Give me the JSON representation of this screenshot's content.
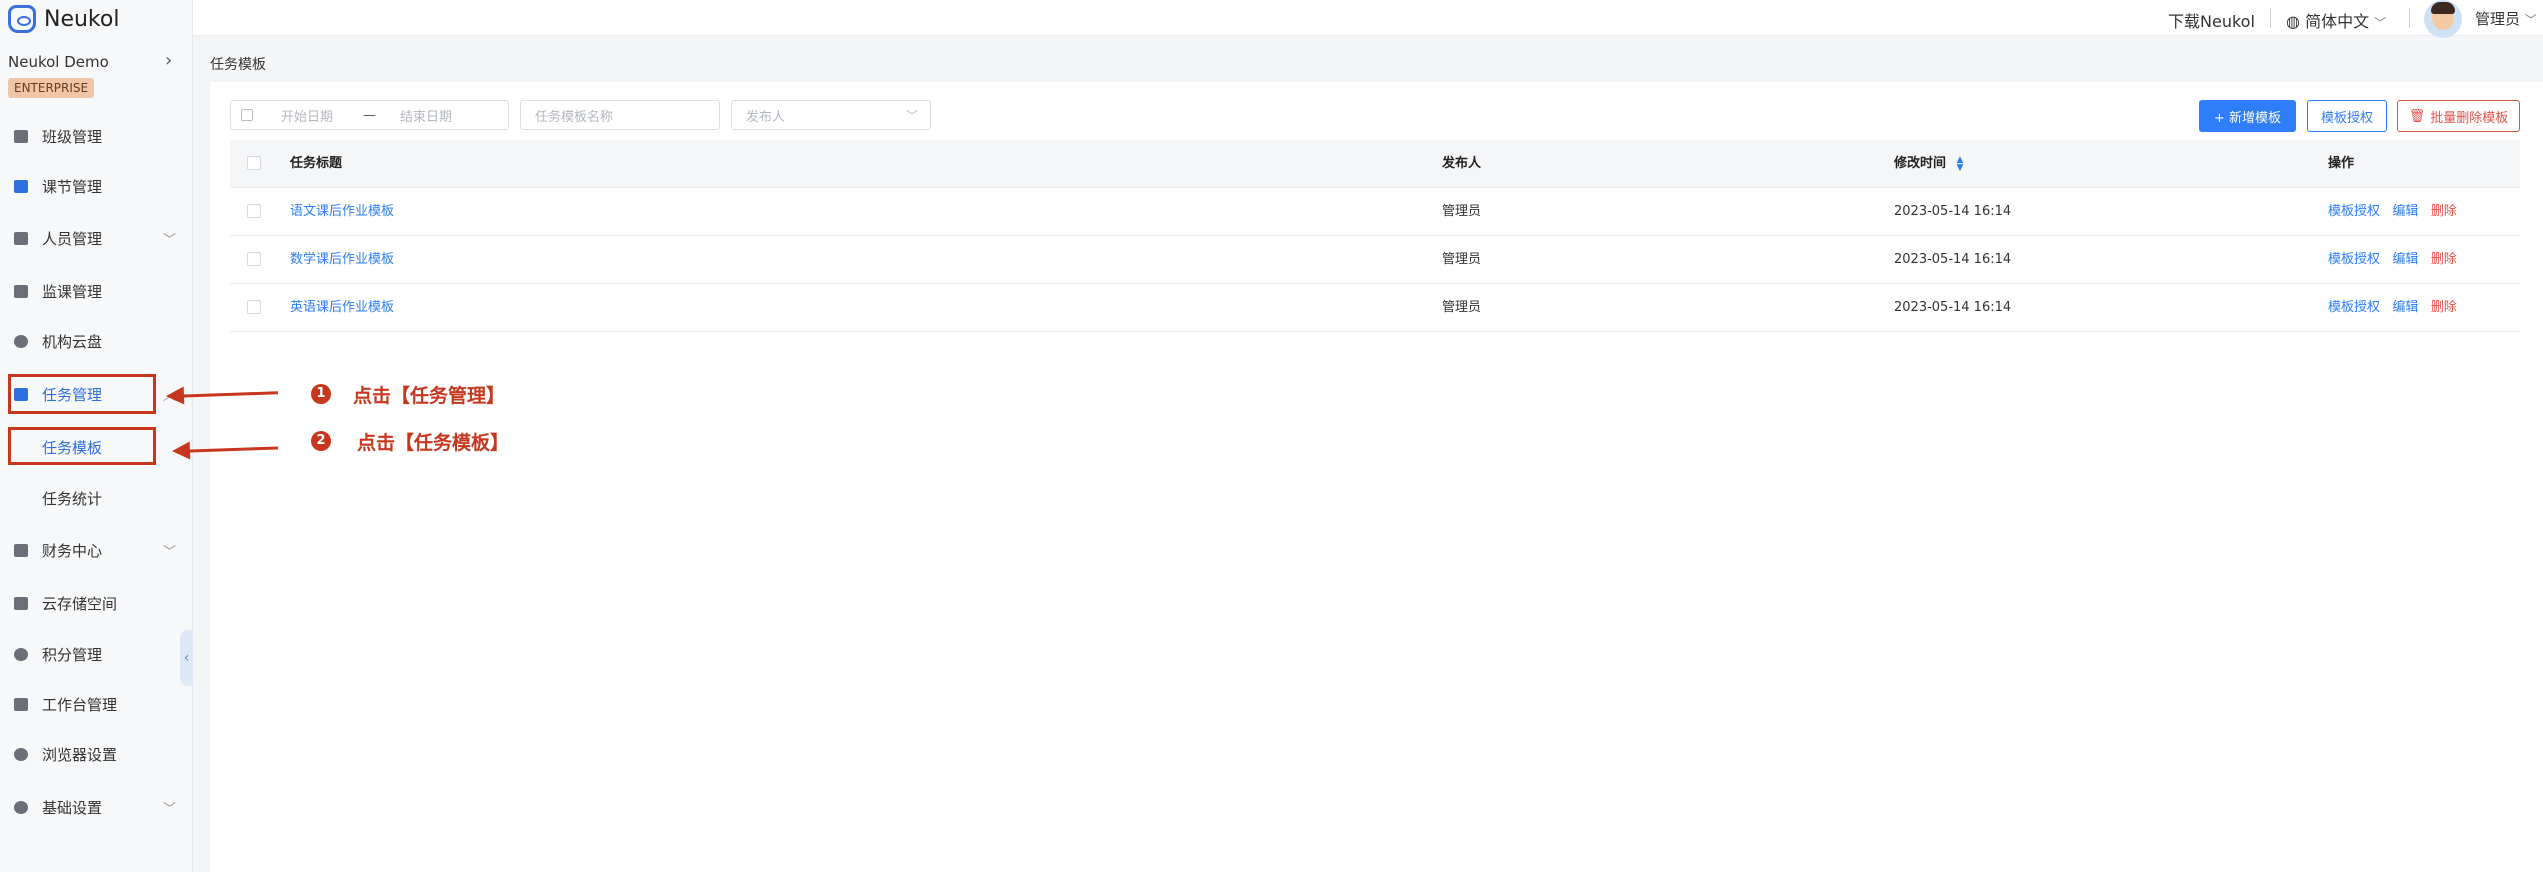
{
  "app": {
    "logo_text": "Neukol",
    "org_name": "Neukol Demo",
    "edition_badge": "ENTERPRISE"
  },
  "topbar": {
    "download": "下载Neukol",
    "language": "简体中文",
    "user": "管理员"
  },
  "sidebar": {
    "items": [
      {
        "label": "班级管理",
        "icon": "class-icon"
      },
      {
        "label": "课节管理",
        "icon": "lesson-icon"
      },
      {
        "label": "人员管理",
        "icon": "people-icon",
        "expandable": true
      },
      {
        "label": "监课管理",
        "icon": "monitor-icon"
      },
      {
        "label": "机构云盘",
        "icon": "cloud-icon"
      },
      {
        "label": "任务管理",
        "icon": "task-icon",
        "expandable": true,
        "active": true
      },
      {
        "label": "任务模板",
        "sub": true,
        "active": true
      },
      {
        "label": "任务统计",
        "sub": true
      },
      {
        "label": "财务中心",
        "icon": "finance-icon",
        "expandable": true
      },
      {
        "label": "云存储空间",
        "icon": "storage-icon"
      },
      {
        "label": "积分管理",
        "icon": "points-icon"
      },
      {
        "label": "工作台管理",
        "icon": "workbench-icon"
      },
      {
        "label": "浏览器设置",
        "icon": "browser-icon"
      },
      {
        "label": "基础设置",
        "icon": "settings-icon",
        "expandable": true
      }
    ]
  },
  "breadcrumb": "任务模板",
  "filters": {
    "start_date_placeholder": "开始日期",
    "end_date_placeholder": "结束日期",
    "range_separator": "—",
    "template_name_placeholder": "任务模板名称",
    "publisher_placeholder": "发布人"
  },
  "actions": {
    "add": "+ 新增模板",
    "authorize": "模板授权",
    "batch_delete": "批量删除模板"
  },
  "table": {
    "headers": {
      "title": "任务标题",
      "publisher": "发布人",
      "modified": "修改时间",
      "ops": "操作"
    },
    "rows": [
      {
        "title": "语文课后作业模板",
        "publisher": "管理员",
        "modified": "2023-05-14 16:14"
      },
      {
        "title": "数学课后作业模板",
        "publisher": "管理员",
        "modified": "2023-05-14 16:14"
      },
      {
        "title": "英语课后作业模板",
        "publisher": "管理员",
        "modified": "2023-05-14 16:14"
      }
    ],
    "row_actions": {
      "authorize": "模板授权",
      "edit": "编辑",
      "delete": "删除"
    }
  },
  "annotations": [
    {
      "num": "1",
      "text": "点击【任务管理】"
    },
    {
      "num": "2",
      "text": "点击【任务模板】"
    }
  ],
  "colors": {
    "accent": "#2f7ef7",
    "danger": "#e0524b",
    "annotation": "#c7371d"
  }
}
